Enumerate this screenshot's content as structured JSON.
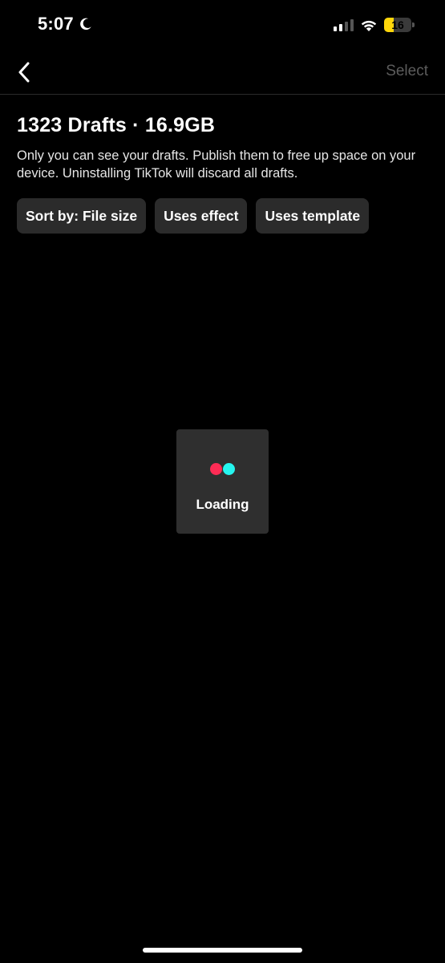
{
  "status_bar": {
    "time": "5:07",
    "battery_level": "16",
    "battery_color": "#ffd60a",
    "icons": [
      "moon-icon",
      "signal-icon",
      "wifi-icon",
      "battery-icon"
    ]
  },
  "nav": {
    "back_icon": "chevron-left-icon",
    "select_label": "Select"
  },
  "header": {
    "title": "1323 Drafts · 16.9GB",
    "description": "Only you can see your drafts. Publish them to free up space on your device. Uninstalling TikTok will discard all drafts."
  },
  "filters": [
    {
      "label": "Sort by: File size"
    },
    {
      "label": "Uses effect"
    },
    {
      "label": "Uses template"
    }
  ],
  "loading": {
    "label": "Loading",
    "dot_colors": [
      "#fe2c55",
      "#25f4ee"
    ]
  }
}
